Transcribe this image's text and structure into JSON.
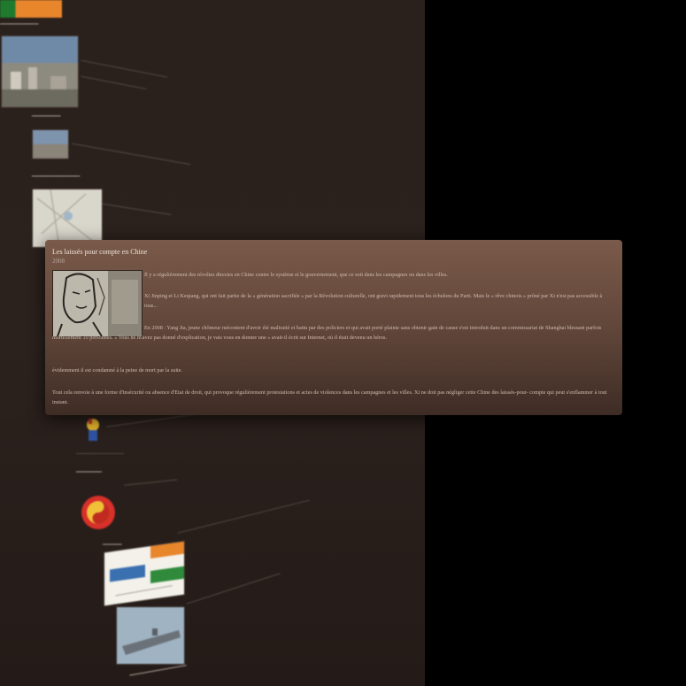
{
  "popup": {
    "title": "Les laissés pour compte en Chine",
    "year": "2008",
    "paragraphs": [
      "Il y a régulièrement des révoltes directes en Chine contre le système et le gouvernement, que ce soit dans les campagnes ou dans les villes.",
      "Xi Jinping et Li Keqiang, qui ont fait partie de la « génération sacrifiée » par la Révolution culturelle, ont gravi rapidement tous les échelons du Parti. Mais le « rêve chinois » prôné par Xi n'est pas accessible à tous...",
      "En 2008 : Yang Jia, jeune chômeur mécontent d'avoir été maltraité et battu par des policiers et qui avait porté plainte sans obtenir gain de cause s'est introduit dans un commissariat de Shanghai blessant parfois mortellement 10 personnes. « Vous ne m'avez pas donné d'explication, je vais vous en donner une » avait-il écrit sur Internet, où il était devenu un héros.",
      "évidemment il est condamné à la peine de mort par la suite.",
      "Tout cela renvoie à une forme d'insécurité ou absence d'Etat de droit, qui provoque régulièrement protestations et actes de violences dans les campagnes et les villes. Xi ne doit pas négliger cette Chine des laissés-pour- compte qui peut s'enflammer à tout instant."
    ]
  },
  "colors": {
    "background": "#000000",
    "panel": "#2a201c",
    "popup_top": "#7a5a4a",
    "popup_bottom": "#3e2c25"
  }
}
